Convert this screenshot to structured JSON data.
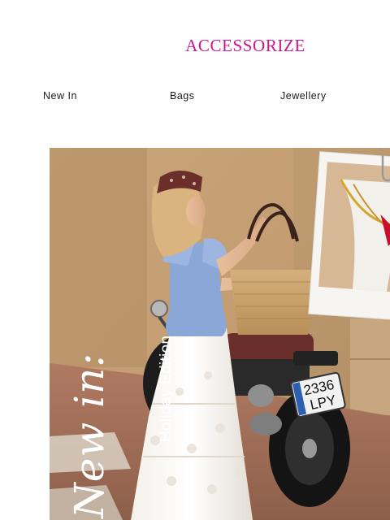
{
  "brand": {
    "logo_text": "ACCESSORIZE",
    "logo_color": "#d0168e"
  },
  "nav": {
    "items": [
      {
        "label": "New In"
      },
      {
        "label": "Bags"
      },
      {
        "label": "Jewellery"
      }
    ]
  },
  "hero": {
    "headline_script": "New in:",
    "headline_sub": "Holiday Edition",
    "license_plate": {
      "line1": "2336",
      "line2": "LPY"
    }
  }
}
